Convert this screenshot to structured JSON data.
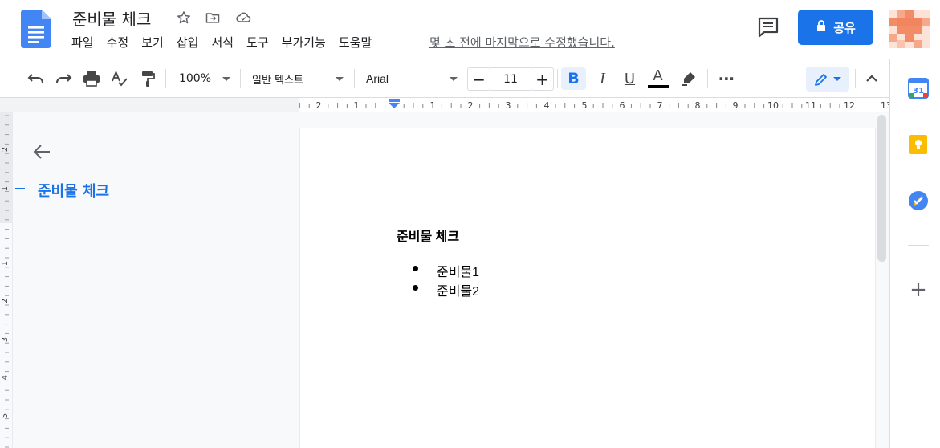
{
  "header": {
    "title": "준비물 체크",
    "menu": [
      "파일",
      "수정",
      "보기",
      "삽입",
      "서식",
      "도구",
      "부가기능",
      "도움말"
    ],
    "last_edit": "몇 초 전에 마지막으로 수정했습니다.",
    "share_label": "공유",
    "icons": [
      "docs-logo-icon",
      "star-icon",
      "move-folder-icon",
      "cloud-saved-icon",
      "comment-icon",
      "lock-icon",
      "avatar"
    ]
  },
  "toolbar": {
    "zoom": "100%",
    "style": "일반 텍스트",
    "font": "Arial",
    "font_size": "11",
    "minus": "−",
    "plus": "+",
    "bold": "B",
    "italic": "I",
    "underline": "U",
    "text_color_glyph": "A",
    "more": "⋯"
  },
  "ruler": {
    "labels": [
      "2",
      "1",
      "1",
      "2",
      "3",
      "4",
      "5",
      "6",
      "7",
      "8",
      "9",
      "10",
      "11",
      "12",
      "13"
    ]
  },
  "vruler": {
    "labels": [
      "2",
      "1",
      "1",
      "2",
      "3",
      "4",
      "5"
    ]
  },
  "outline": {
    "items": [
      "준비물 체크"
    ]
  },
  "document": {
    "heading": "준비물 체크",
    "bullets": [
      "준비물1",
      "준비물2"
    ]
  },
  "sidepanel": {
    "calendar_day": "31",
    "add": "+"
  },
  "colors": {
    "accent": "#1a73e8",
    "docs_blue": "#4285f4",
    "keep_yellow": "#fbbc04",
    "tasks_blue": "#4285f4",
    "avatar_orange": "#f28b66"
  }
}
